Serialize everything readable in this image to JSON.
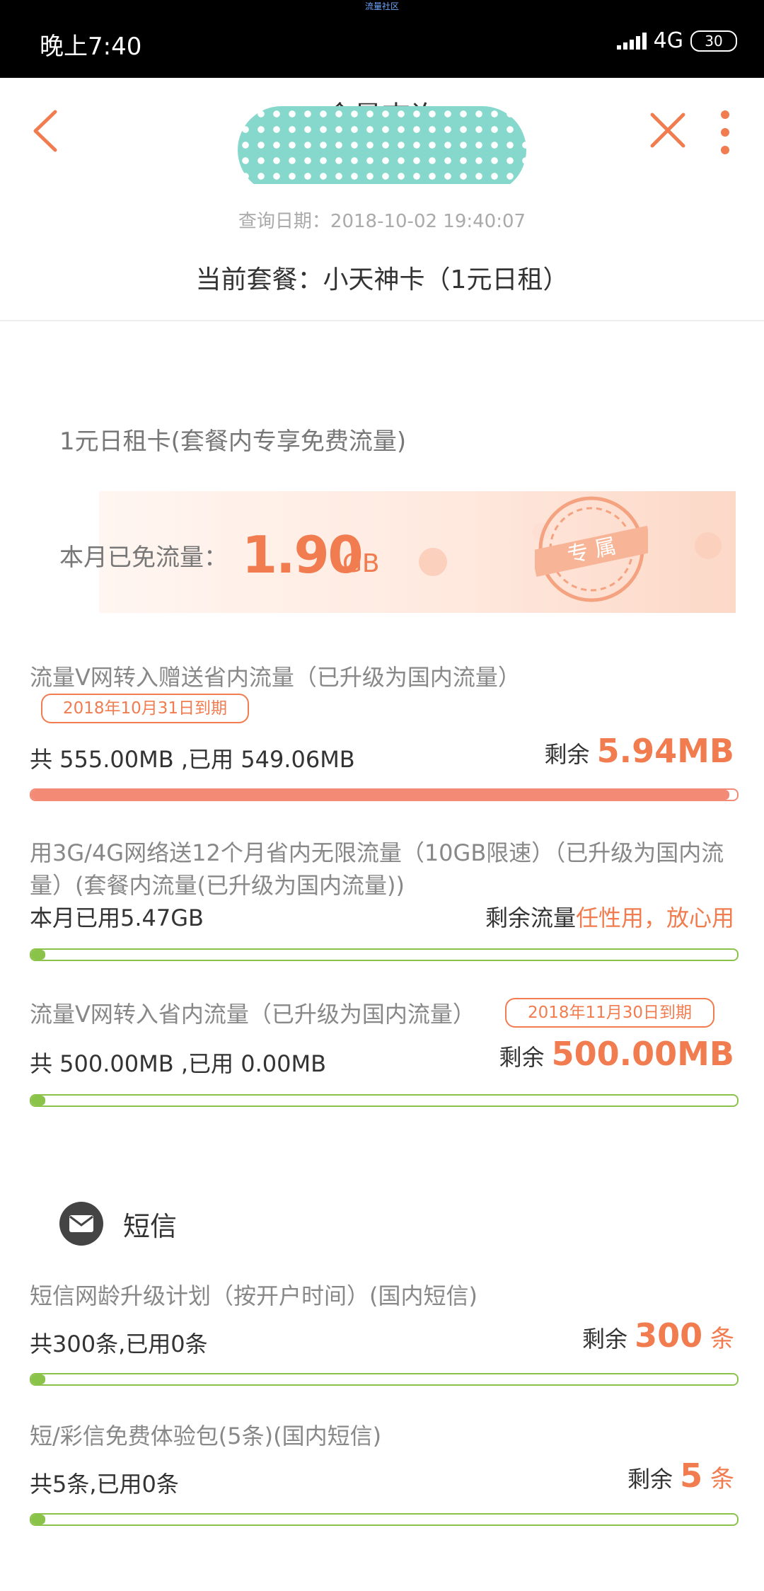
{
  "status_bar": {
    "top_label": "流量社区",
    "time": "晚上7:40",
    "network": "4G",
    "battery": "30"
  },
  "nav": {
    "title": "余量查询"
  },
  "header": {
    "query_date": "查询日期：2018-10-02 19:40:07",
    "plan": "当前套餐：小天神卡（1元日租）"
  },
  "free_card": {
    "title": "1元日租卡(套餐内专享免费流量)",
    "label": "本月已免流量：",
    "value": "1.90",
    "unit": "GB",
    "stamp": "专 属"
  },
  "data_items": [
    {
      "title": "流量V网转入赠送省内流量（已升级为国内流量）",
      "expire": "2018年10月31日到期",
      "usage": "共 555.00MB ,已用 549.06MB",
      "remain_label": "剩余 ",
      "remain_value": "5.94MB",
      "used_fraction": 0.989
    },
    {
      "title": "用3G/4G网络送12个月省内无限流量（10GB限速）（已升级为国内流量）(套餐内流量(已升级为国内流量))",
      "usage": "本月已用5.47GB",
      "remain_label": "剩余流量",
      "remain_value": "任性用，放心用",
      "used_fraction": 0.02
    },
    {
      "title": "流量V网转入省内流量（已升级为国内流量）",
      "expire": "2018年11月30日到期",
      "usage": "共 500.00MB ,已用 0.00MB",
      "remain_label": "剩余 ",
      "remain_value": "500.00MB",
      "used_fraction": 0.02
    }
  ],
  "sms": {
    "title": "短信",
    "items": [
      {
        "title": "短信网龄升级计划（按开户时间）(国内短信)",
        "usage": "共300条,已用0条",
        "remain_label": "剩余 ",
        "remain_value": "300",
        "remain_unit": " 条",
        "used_fraction": 0.02
      },
      {
        "title": "短/彩信免费体验包(5条)(国内短信)",
        "usage": "共5条,已用0条",
        "remain_label": "剩余 ",
        "remain_value": "5",
        "remain_unit": " 条",
        "used_fraction": 0.02
      }
    ]
  },
  "colors": {
    "accent": "#f07c4f",
    "progress_green": "#8bc34a",
    "progress_red": "#f28a76"
  }
}
